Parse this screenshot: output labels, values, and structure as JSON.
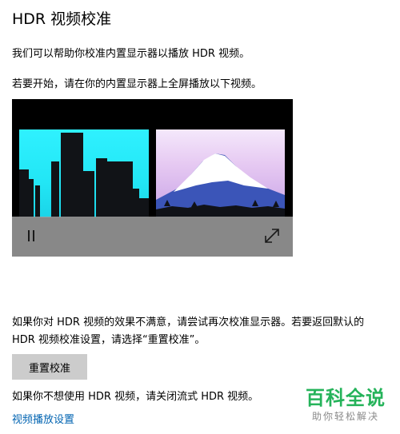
{
  "page": {
    "title": "HDR 视频校准",
    "intro": "我们可以帮助你校准内置显示器以播放 HDR 视频。",
    "instruction": "若要开始，请在你的内置显示器上全屏播放以下视频。",
    "retry_text": "如果你对 HDR 视频的效果不满意，请尝试再次校准显示器。若要返回默认的 HDR 视频校准设置，请选择“重置校准”。",
    "reset_button_label": "重置校准",
    "disable_text": "如果你不想使用 HDR 视频，请关闭流式 HDR 视频。",
    "settings_link": "视频播放设置"
  },
  "video_player": {
    "pause_icon": "pause-icon",
    "fullscreen_icon": "fullscreen-expand-icon",
    "left_frame": "city-skyline",
    "right_frame": "snowy-mountain"
  },
  "watermark": {
    "main": "百科全说",
    "sub": "助你轻松解决"
  },
  "colors": {
    "link": "#0063b1",
    "button_bg": "#cccccc",
    "watermark_green": "#25b35a"
  }
}
